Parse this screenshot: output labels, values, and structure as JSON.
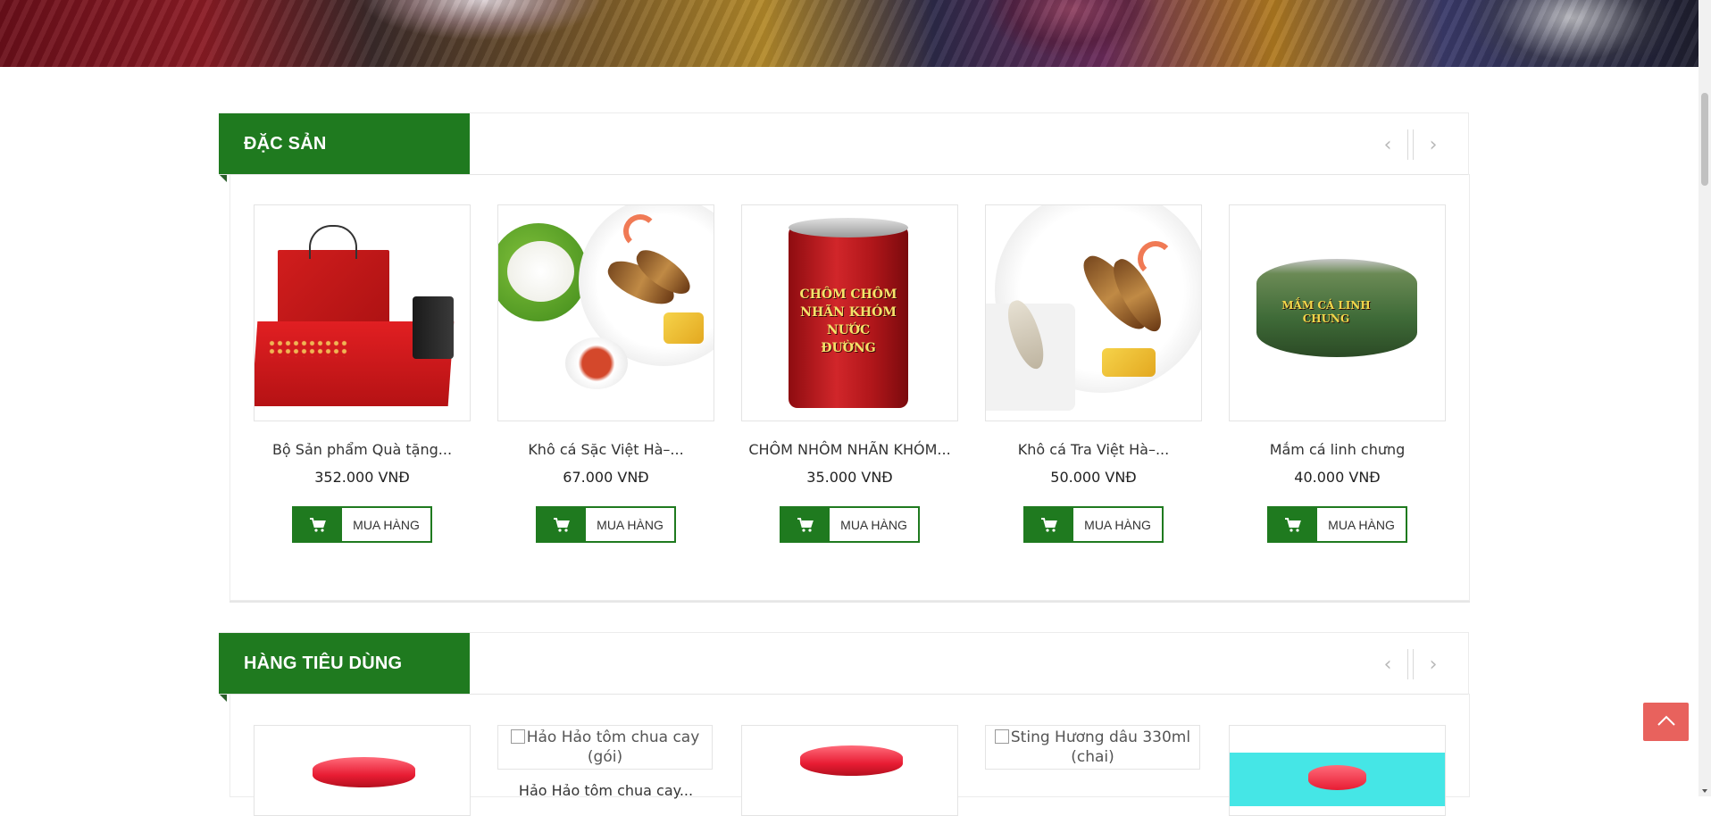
{
  "sections": [
    {
      "title": "ĐẶC SẢN",
      "products": [
        {
          "name": "Bộ Sản phẩm Quà tặng...",
          "price": "352.000 VNĐ",
          "buy_label": "MUA HÀNG"
        },
        {
          "name": "Khô cá Sặc Việt Hà–...",
          "price": "67.000 VNĐ",
          "buy_label": "MUA HÀNG"
        },
        {
          "name": "CHÔM NHÔM NHÃN KHÓM...",
          "price": "35.000 VNĐ",
          "buy_label": "MUA HÀNG",
          "image_text": "CHÔM CHÔM NHÃN KHÓM NƯỚC ĐƯỜNG"
        },
        {
          "name": "Khô cá Tra Việt Hà–...",
          "price": "50.000 VNĐ",
          "buy_label": "MUA HÀNG"
        },
        {
          "name": "Mắm cá linh chưng",
          "price": "40.000 VNĐ",
          "buy_label": "MUA HÀNG",
          "image_text": "MẮM CÁ LINH CHƯNG"
        }
      ]
    },
    {
      "title": "HÀNG TIÊU DÙNG",
      "products": [
        {
          "name": ""
        },
        {
          "name": "Hảo Hảo tôm chua cay...",
          "image_alt": "Hảo Hảo tôm chua cay (gói)"
        },
        {
          "name": ""
        },
        {
          "name": "",
          "image_alt": "Sting Hương dâu 330ml (chai)"
        },
        {
          "name": ""
        }
      ]
    }
  ],
  "colors": {
    "brand_green": "#1f7a1f",
    "back_to_top": "#e8625d"
  },
  "icons": {
    "prev": "chevron-left-icon",
    "next": "chevron-right-icon",
    "cart": "cart-icon",
    "back_to_top": "chevron-up-icon"
  }
}
